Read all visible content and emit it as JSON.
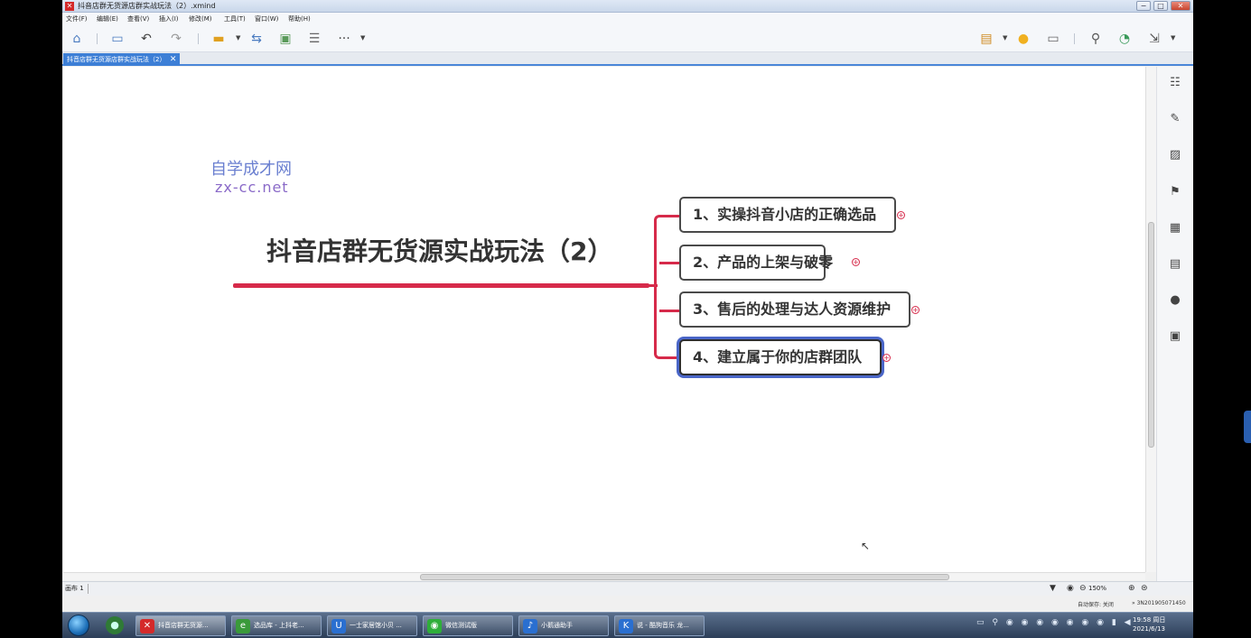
{
  "window": {
    "title": "抖音店群无货源店群实战玩法（2）.xmind",
    "app_icon": "xmind-icon",
    "minimize": "−",
    "maximize": "□",
    "close": "✕"
  },
  "menu": [
    "文件(F)",
    "编辑(E)",
    "查看(V)",
    "插入(I)",
    "修改(M)",
    "工具(T)",
    "窗口(W)",
    "帮助(H)"
  ],
  "toolbar": {
    "more": "···"
  },
  "tab": {
    "label": "抖音店群无货源店群实战玩法（2）",
    "close": "✕"
  },
  "watermark": {
    "cn": "自学成才网",
    "en": "zx-cc.net"
  },
  "mindmap": {
    "central": "抖音店群无货源实战玩法（2）",
    "topics": [
      "1、实操抖音小店的正确选品",
      "2、产品的上架与破零",
      "3、售后的处理与达人资源维护",
      "4、建立属于你的店群团队"
    ],
    "selected_index": 3,
    "expander": "+"
  },
  "statusbar": {
    "sheet": "画布 1",
    "zoom": "150%",
    "autosave": "自动保存: 关闭",
    "build": "» 3N201905071450"
  },
  "taskbar": {
    "items": [
      {
        "label": "抖音店群无货源...",
        "icon": "xmind-icon",
        "color": "#d42a2a",
        "glyph": "✕"
      },
      {
        "label": "选品库 - 上抖老...",
        "icon": "browser-icon",
        "color": "#3a9a3a",
        "glyph": "e"
      },
      {
        "label": "一士家居馆小贝 ...",
        "icon": "shop-icon",
        "color": "#2a6fd0",
        "glyph": "U"
      },
      {
        "label": "微信测试版",
        "icon": "wechat-icon",
        "color": "#2fae3a",
        "glyph": "◉"
      },
      {
        "label": "小鹅通助手",
        "icon": "xiaoe-icon",
        "color": "#2a6fd0",
        "glyph": "♪"
      },
      {
        "label": "说 - 酷狗音乐 龙...",
        "icon": "kugou-icon",
        "color": "#2a6fd0",
        "glyph": "K"
      }
    ],
    "clock_time": "19:58 周日",
    "clock_date": "2021/6/13"
  },
  "colors": {
    "accent": "#d62a4a",
    "selection": "#4a66c8",
    "tab": "#3d7fd6"
  }
}
